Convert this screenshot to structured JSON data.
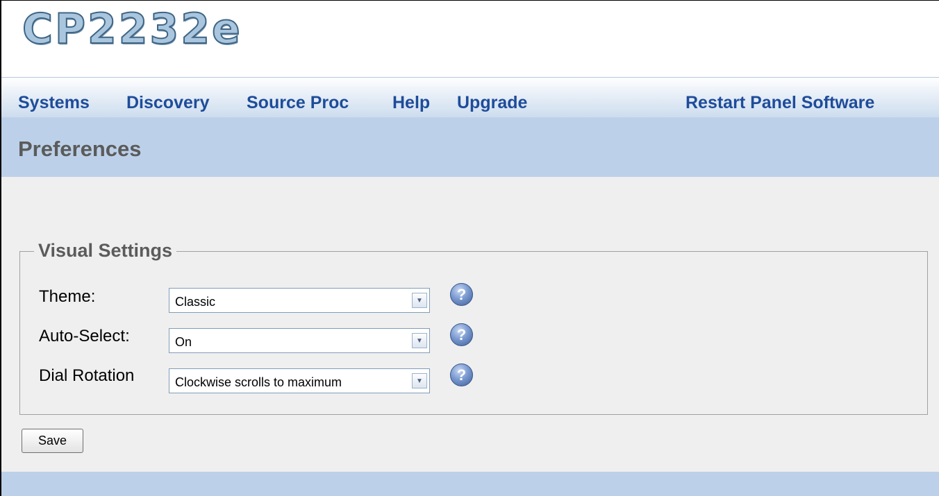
{
  "header": {
    "logo_text": "CP2232e"
  },
  "nav": {
    "items": [
      {
        "label": "Systems"
      },
      {
        "label": "Discovery"
      },
      {
        "label": "Source Proc"
      },
      {
        "label": "Help"
      },
      {
        "label": "Upgrade"
      }
    ],
    "restart_label": "Restart Panel Software"
  },
  "page": {
    "title": "Preferences"
  },
  "visual_settings": {
    "legend": "Visual Settings",
    "rows": [
      {
        "label": "Theme:",
        "value": "Classic",
        "help_icon": "question-mark-icon"
      },
      {
        "label": "Auto-Select:",
        "value": "On",
        "help_icon": "question-mark-icon"
      },
      {
        "label": "Dial Rotation",
        "value": "Clockwise scrolls to maximum",
        "help_icon": "question-mark-icon"
      }
    ],
    "help_glyph": "?",
    "dropdown_glyph": "▼"
  },
  "actions": {
    "save_label": "Save"
  },
  "colors": {
    "accent": "#1e4c9a",
    "title_bar": "#bcd1e9",
    "content_bg": "#efefef"
  }
}
